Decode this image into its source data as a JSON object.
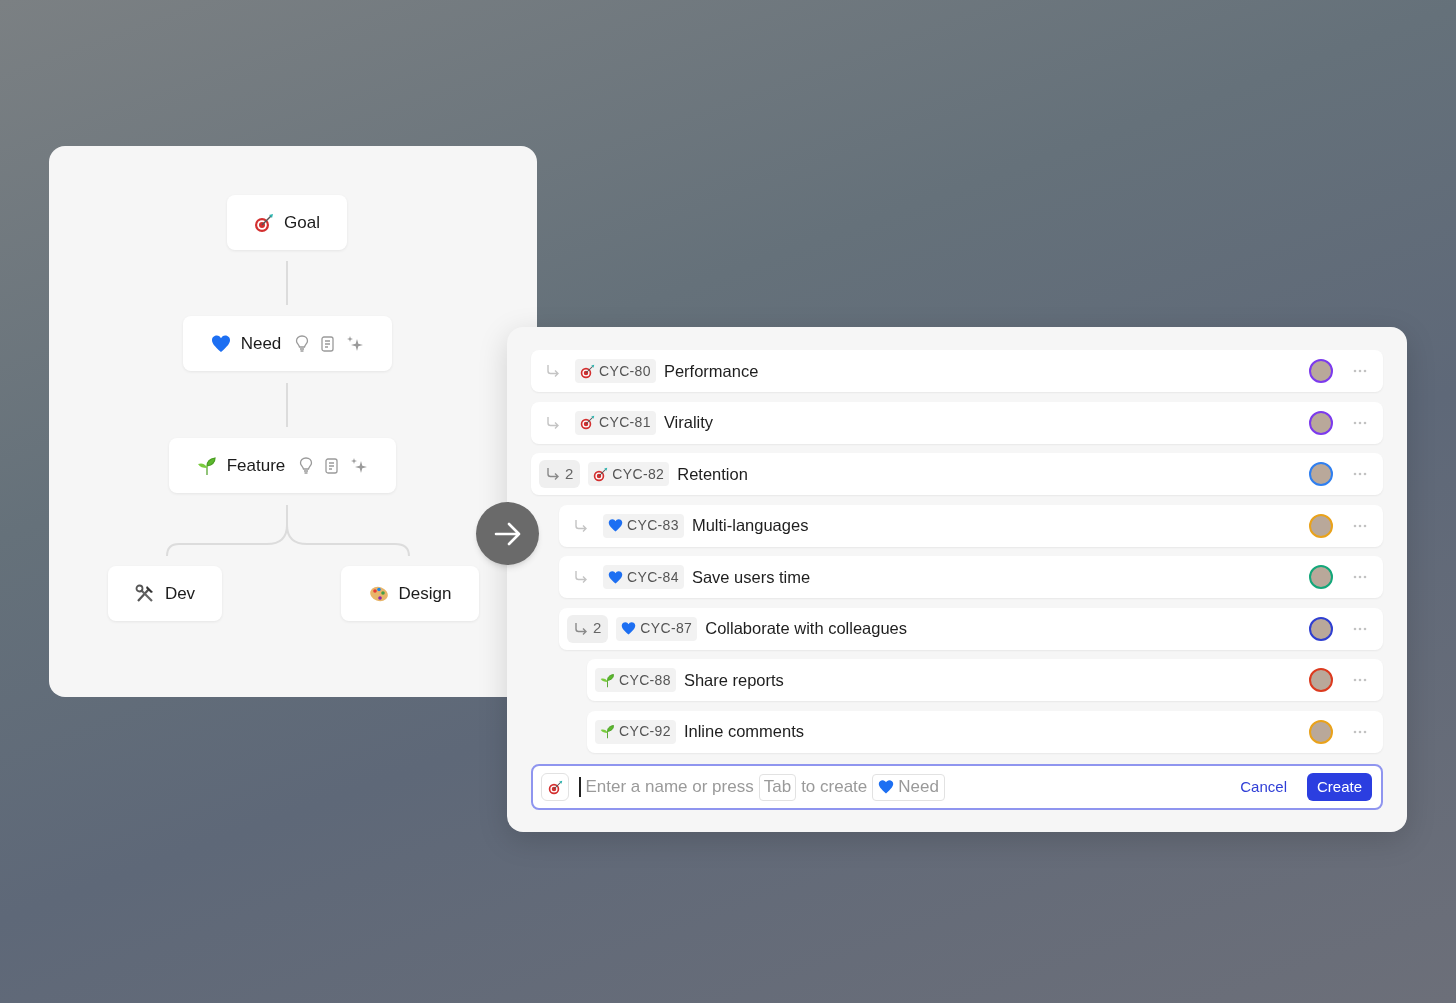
{
  "hierarchy": {
    "nodes": [
      {
        "kind": "goal",
        "label": "Goal",
        "tools": false
      },
      {
        "kind": "need",
        "label": "Need",
        "tools": true
      },
      {
        "kind": "feature",
        "label": "Feature",
        "tools": true
      },
      {
        "kind": "dev",
        "label": "Dev",
        "tools": false
      },
      {
        "kind": "design",
        "label": "Design",
        "tools": false
      }
    ]
  },
  "items": [
    {
      "kind": "goal",
      "id": "CYC-80",
      "title": "Performance",
      "color": "#7c3aed"
    },
    {
      "kind": "goal",
      "id": "CYC-81",
      "title": "Virality",
      "color": "#7c3aed"
    },
    {
      "kind": "goal",
      "id": "CYC-82",
      "title": "Retention",
      "sub_count": "2",
      "color": "#2f7ff0",
      "children": [
        {
          "kind": "need",
          "id": "CYC-83",
          "title": "Multi-languages",
          "color": "#e9a21b"
        },
        {
          "kind": "need",
          "id": "CYC-84",
          "title": "Save users time",
          "color": "#13a77a"
        },
        {
          "kind": "need",
          "id": "CYC-87",
          "title": "Collaborate with colleagues",
          "sub_count": "2",
          "color": "#2f3fd1",
          "children": [
            {
              "kind": "feature",
              "id": "CYC-88",
              "title": "Share reports",
              "color": "#dc3a1f"
            },
            {
              "kind": "feature",
              "id": "CYC-92",
              "title": "Inline comments",
              "color": "#e9a21b"
            }
          ]
        }
      ]
    }
  ],
  "composer": {
    "kind": "goal",
    "hint_before": "Enter a name or press",
    "key": "Tab",
    "hint_after": "to create",
    "chip": {
      "kind": "need",
      "label": "Need"
    },
    "cancel": "Cancel",
    "create": "Create"
  }
}
